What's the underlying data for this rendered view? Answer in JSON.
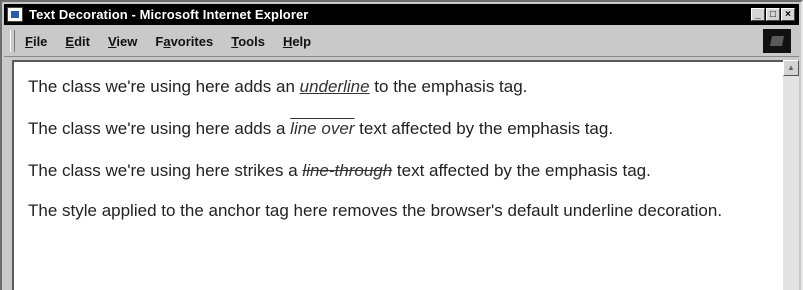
{
  "window": {
    "title": "Text Decoration - Microsoft Internet Explorer",
    "buttons": {
      "minimize": "_",
      "maximize": "□",
      "close": "×"
    }
  },
  "menu": [
    {
      "pre": "",
      "key": "F",
      "post": "ile"
    },
    {
      "pre": "",
      "key": "E",
      "post": "dit"
    },
    {
      "pre": "",
      "key": "V",
      "post": "iew"
    },
    {
      "pre": "F",
      "key": "a",
      "post": "vorites"
    },
    {
      "pre": "",
      "key": "T",
      "post": "ools"
    },
    {
      "pre": "",
      "key": "H",
      "post": "elp"
    }
  ],
  "content": {
    "p1": {
      "before": "The class we're using here adds an ",
      "em": "underline",
      "after": " to the emphasis tag."
    },
    "p2": {
      "before": "The class we're using here adds a ",
      "em": "line over",
      "after": " text affected by the emphasis tag."
    },
    "p3": {
      "before": "The class we're using here strikes a ",
      "em": "line-through",
      "after": " text affected by the emphasis tag."
    },
    "p4": {
      "text": "The style applied to the anchor tag here removes the browser's default underline decoration."
    }
  }
}
